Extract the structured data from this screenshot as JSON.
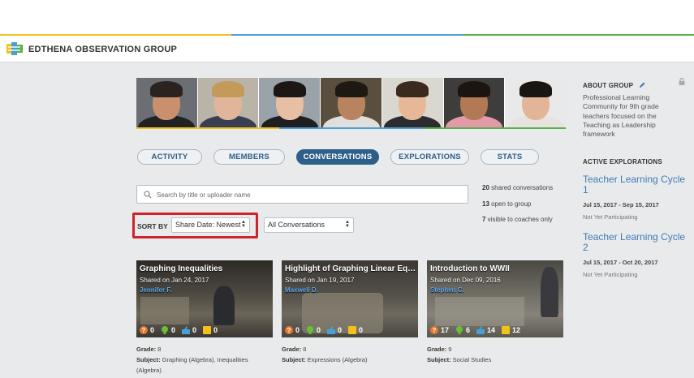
{
  "group": {
    "title": "EDTHENA OBSERVATION GROUP"
  },
  "tabs": [
    {
      "label": "ACTIVITY"
    },
    {
      "label": "MEMBERS"
    },
    {
      "label": "CONVERSATIONS"
    },
    {
      "label": "EXPLORATIONS"
    },
    {
      "label": "STATS"
    }
  ],
  "search": {
    "placeholder": "Search by title or uploader name"
  },
  "stats": [
    {
      "count": "20",
      "text": " shared conversations"
    },
    {
      "count": "13",
      "text": " open to group"
    },
    {
      "count": "7",
      "text": " visible to coaches only"
    }
  ],
  "sort": {
    "label": "SORT BY",
    "value": "Share Date: Newest"
  },
  "filter": {
    "value": "All Conversations"
  },
  "cards": [
    {
      "title": "Graphing Inequalities",
      "shared": "Shared on Jan 24, 2017",
      "author": "Jennifer F.",
      "counts": [
        "0",
        "0",
        "0",
        "0"
      ],
      "grade": "8",
      "subject_line1": "Graphing (Algebra), Inequalities",
      "subject_line2": "(Algebra)"
    },
    {
      "title": "Highlight of Graphing Linear Equati...",
      "shared": "Shared on Jan 19, 2017",
      "author": "Maxwell D.",
      "counts": [
        "0",
        "0",
        "0",
        "0"
      ],
      "grade": "8",
      "subject_line1": "Expressions (Algebra)",
      "subject_line2": ""
    },
    {
      "title": "Introduction to WWII",
      "shared": "Shared on Dec 09, 2016",
      "author": "Stephen C.",
      "counts": [
        "17",
        "6",
        "14",
        "12"
      ],
      "grade": "9",
      "subject_line1": "Social Studies",
      "subject_line2": ""
    }
  ],
  "meta_labels": {
    "grade": "Grade: ",
    "subject": "Subject: "
  },
  "sidebar": {
    "about_heading": "ABOUT GROUP",
    "about_text": "Professional Learning Community for 9th grade teachers focused on the Teaching as Leadership framework",
    "explorations_heading": "ACTIVE EXPLORATIONS",
    "explorations": [
      {
        "title": "Teacher Learning Cycle 1",
        "dates": "Jul 15, 2017 - Sep 15, 2017",
        "status": "Not Yet Participating"
      },
      {
        "title": "Teacher Learning Cycle 2",
        "dates": "Jul 15, 2017 - Oct 20, 2017",
        "status": "Not Yet Participating"
      }
    ]
  },
  "colors": {
    "accent": "#2e5f8a",
    "link": "#3f7bb6",
    "highlight_box": "#d0232a"
  }
}
